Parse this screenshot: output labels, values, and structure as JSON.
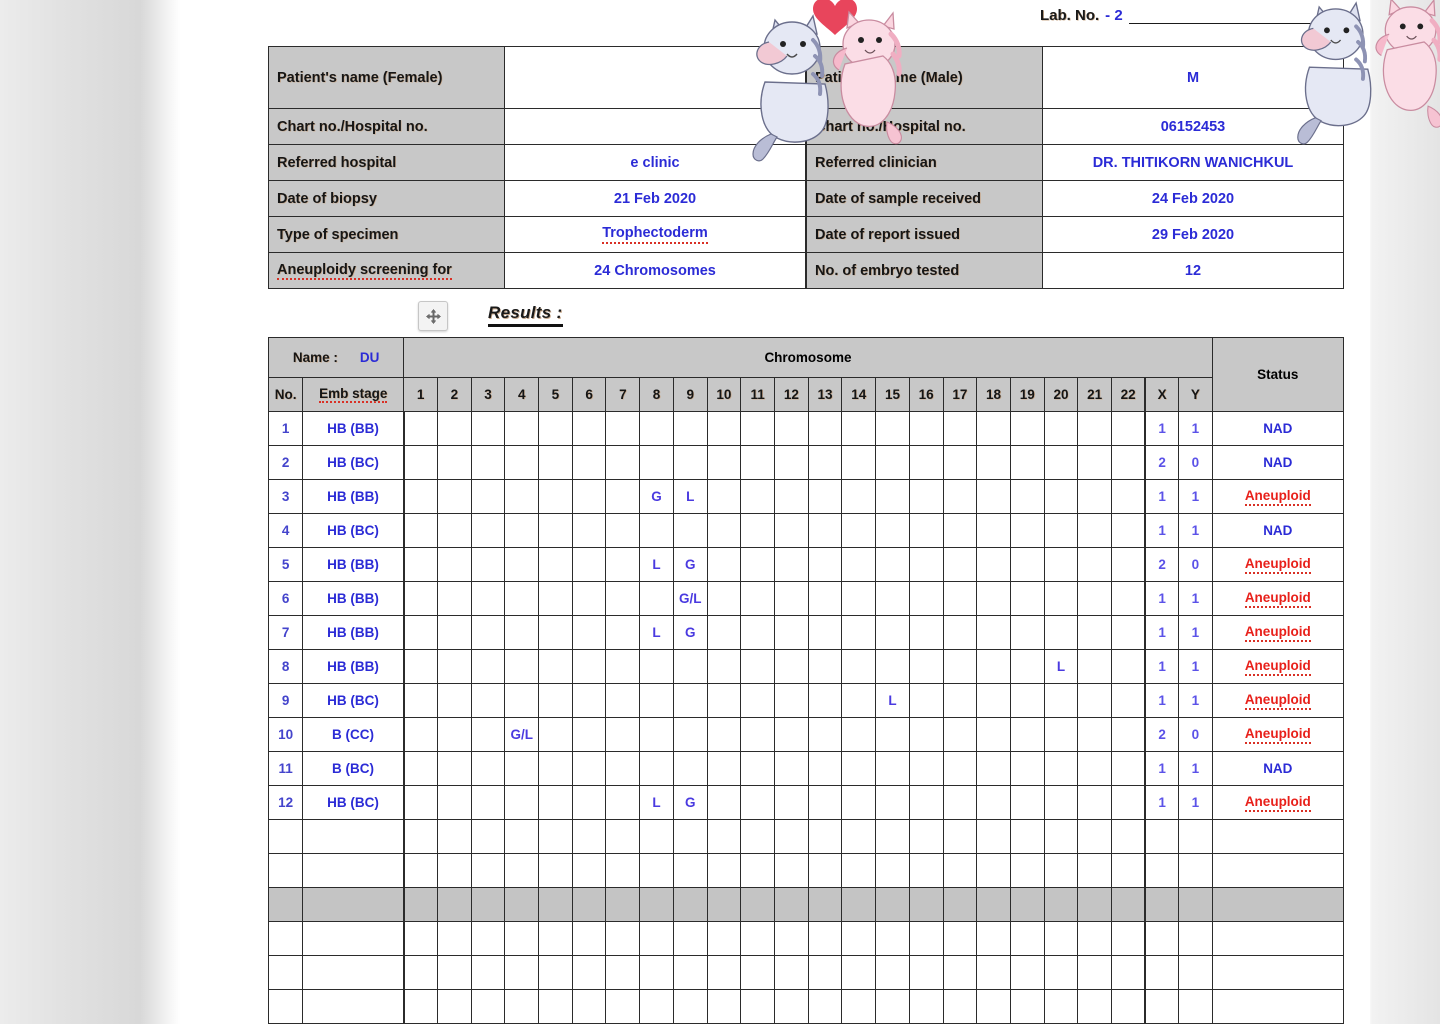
{
  "header": {
    "lab_no_label": "Lab. No.",
    "lab_no_value": "- 2"
  },
  "info_left": {
    "rows": [
      {
        "label": "Patient's name (Female)",
        "value": "",
        "tall": true
      },
      {
        "label": "Chart no./Hospital no.",
        "value": ""
      },
      {
        "label": "Referred hospital",
        "value": "e clinic"
      },
      {
        "label": "Date of biopsy",
        "value": "21 Feb 2020"
      },
      {
        "label": "Type of specimen",
        "value": "Trophectoderm",
        "squiggle": true
      },
      {
        "label": "Aneuploidy screening for",
        "value": "24 Chromosomes",
        "label_squiggle": true
      }
    ]
  },
  "info_right": {
    "rows": [
      {
        "label": "Patient's name (Male)",
        "value": "M",
        "tall": true
      },
      {
        "label": "Chart no./Hospital no.",
        "value": "06152453"
      },
      {
        "label": "Referred clinician",
        "value": "DR. THITIKORN WANICHKUL"
      },
      {
        "label": "Date of sample received",
        "value": "24 Feb 2020"
      },
      {
        "label": "Date of report issued",
        "value": "29 Feb 2020"
      },
      {
        "label": "No. of embryo tested",
        "value": "12"
      }
    ]
  },
  "results": {
    "title": "Results :",
    "move_icon": "move-handle-icon",
    "name_label": "Name :",
    "name_value": "DU",
    "chromosome_group_label": "Chromosome",
    "status_header": "Status",
    "no_header": "No.",
    "emb_stage_header": "Emb stage",
    "chromosome_columns": [
      "1",
      "2",
      "3",
      "4",
      "5",
      "6",
      "7",
      "8",
      "9",
      "10",
      "11",
      "12",
      "13",
      "14",
      "15",
      "16",
      "17",
      "18",
      "19",
      "20",
      "21",
      "22"
    ],
    "sex_columns": [
      "X",
      "Y"
    ],
    "rows": [
      {
        "no": "1",
        "emb_stage": "HB (BB)",
        "markers": {},
        "x": "1",
        "y": "1",
        "status": "NAD",
        "status_kind": "nad"
      },
      {
        "no": "2",
        "emb_stage": "HB (BC)",
        "markers": {},
        "x": "2",
        "y": "0",
        "status": "NAD",
        "status_kind": "nad"
      },
      {
        "no": "3",
        "emb_stage": "HB (BB)",
        "markers": {
          "8": "G",
          "9": "L"
        },
        "x": "1",
        "y": "1",
        "status": "Aneuploid",
        "status_kind": "aneuploid"
      },
      {
        "no": "4",
        "emb_stage": "HB (BC)",
        "markers": {},
        "x": "1",
        "y": "1",
        "status": "NAD",
        "status_kind": "nad"
      },
      {
        "no": "5",
        "emb_stage": "HB (BB)",
        "markers": {
          "8": "L",
          "9": "G"
        },
        "x": "2",
        "y": "0",
        "status": "Aneuploid",
        "status_kind": "aneuploid"
      },
      {
        "no": "6",
        "emb_stage": "HB (BB)",
        "markers": {
          "9": "G/L"
        },
        "x": "1",
        "y": "1",
        "status": "Aneuploid",
        "status_kind": "aneuploid"
      },
      {
        "no": "7",
        "emb_stage": "HB (BB)",
        "markers": {
          "8": "L",
          "9": "G"
        },
        "x": "1",
        "y": "1",
        "status": "Aneuploid",
        "status_kind": "aneuploid"
      },
      {
        "no": "8",
        "emb_stage": "HB (BB)",
        "markers": {
          "20": "L"
        },
        "x": "1",
        "y": "1",
        "status": "Aneuploid",
        "status_kind": "aneuploid"
      },
      {
        "no": "9",
        "emb_stage": "HB (BC)",
        "markers": {
          "15": "L"
        },
        "x": "1",
        "y": "1",
        "status": "Aneuploid",
        "status_kind": "aneuploid"
      },
      {
        "no": "10",
        "emb_stage": "B (CC)",
        "markers": {
          "4": "G/L"
        },
        "x": "2",
        "y": "0",
        "status": "Aneuploid",
        "status_kind": "aneuploid"
      },
      {
        "no": "11",
        "emb_stage": "B (BC)",
        "markers": {},
        "x": "1",
        "y": "1",
        "status": "NAD",
        "status_kind": "nad"
      },
      {
        "no": "12",
        "emb_stage": "HB (BC)",
        "markers": {
          "8": "L",
          "9": "G"
        },
        "x": "1",
        "y": "1",
        "status": "Aneuploid",
        "status_kind": "aneuploid"
      }
    ],
    "empty_rows": [
      {
        "selected": false
      },
      {
        "selected": false
      },
      {
        "selected": true
      },
      {
        "selected": false
      },
      {
        "selected": false
      },
      {
        "selected": false
      }
    ]
  },
  "controls": {
    "add_button_label": "+"
  },
  "decorations": {
    "sticker": "two-cats-hugging-with-heart-sticker",
    "heart_color": "#e8455c",
    "cat_left_color": "#dde0ef",
    "cat_right_color": "#fbd6e0"
  }
}
